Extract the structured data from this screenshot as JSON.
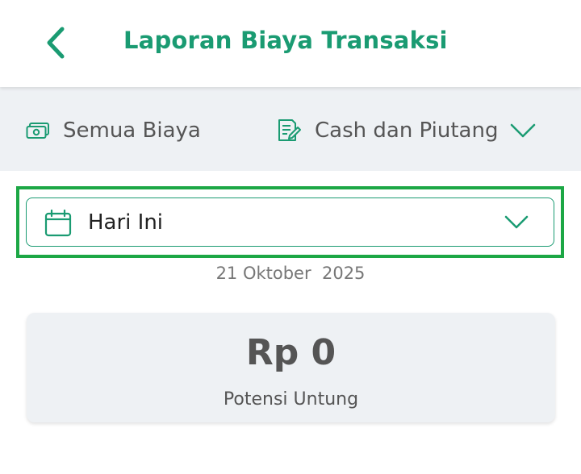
{
  "header": {
    "title": "Laporan Biaya Transaksi",
    "back_icon": "chevron-left-icon"
  },
  "filters": {
    "cost": {
      "icon": "money-icon",
      "label": "Semua Biaya"
    },
    "type": {
      "icon": "document-edit-icon",
      "label": "Cash dan Piutang",
      "dropdown_icon": "chevron-down-icon"
    }
  },
  "date_filter": {
    "icon": "calendar-icon",
    "selected": "Hari Ini",
    "dropdown_icon": "chevron-down-icon",
    "date_text": "21 Oktober  2025"
  },
  "summary": {
    "amount": "Rp 0",
    "label": "Potensi Untung"
  },
  "colors": {
    "brand_green": "#1a9b72",
    "highlight_green": "#1ca745",
    "filter_bg": "#eef1f4",
    "text_gray": "#555555"
  }
}
